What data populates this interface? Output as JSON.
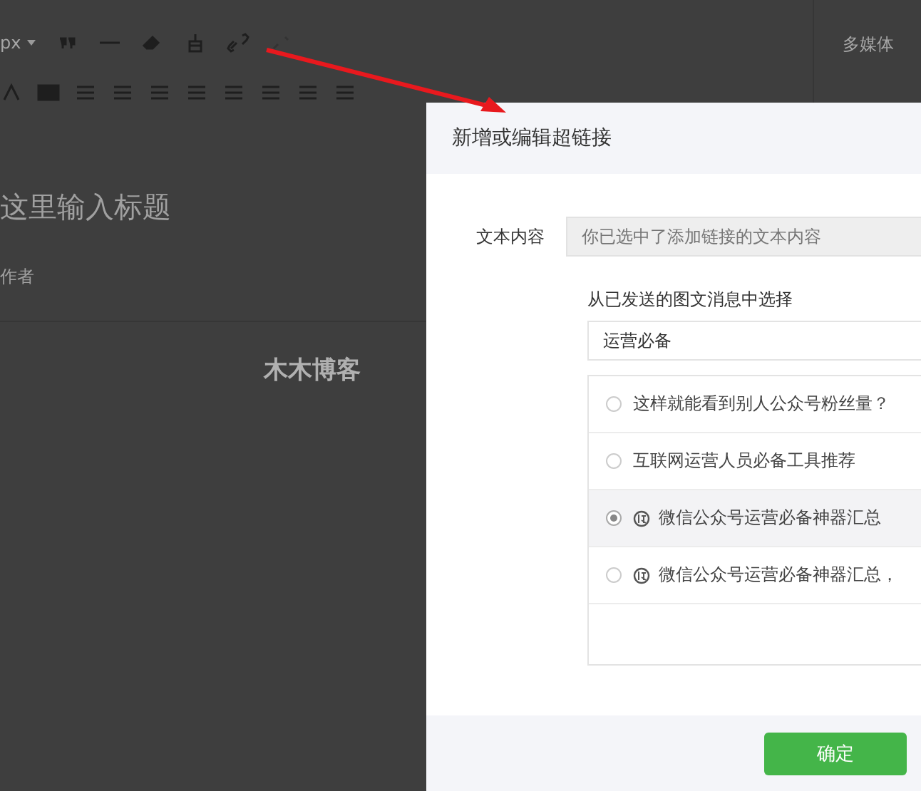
{
  "editor": {
    "font_size": "px",
    "title_placeholder": "这里输入标题",
    "author_placeholder": "作者",
    "body_text": "木木博客",
    "side_tab": "多媒体"
  },
  "dialog": {
    "title": "新增或编辑超链接",
    "text_label": "文本内容",
    "text_placeholder": "你已选中了添加链接的文本内容",
    "picker_label": "从已发送的图文消息中选择",
    "search_value": "运营必备",
    "articles": [
      {
        "title": "这样就能看到别人公众号粉丝量？",
        "tag_icon": false,
        "selected": false
      },
      {
        "title": "互联网运营人员必备工具推荐",
        "tag_icon": false,
        "selected": false
      },
      {
        "title": "微信公众号运营必备神器汇总",
        "tag_icon": true,
        "selected": true
      },
      {
        "title": "微信公众号运营必备神器汇总，",
        "tag_icon": true,
        "selected": false
      }
    ],
    "confirm": "确定"
  }
}
